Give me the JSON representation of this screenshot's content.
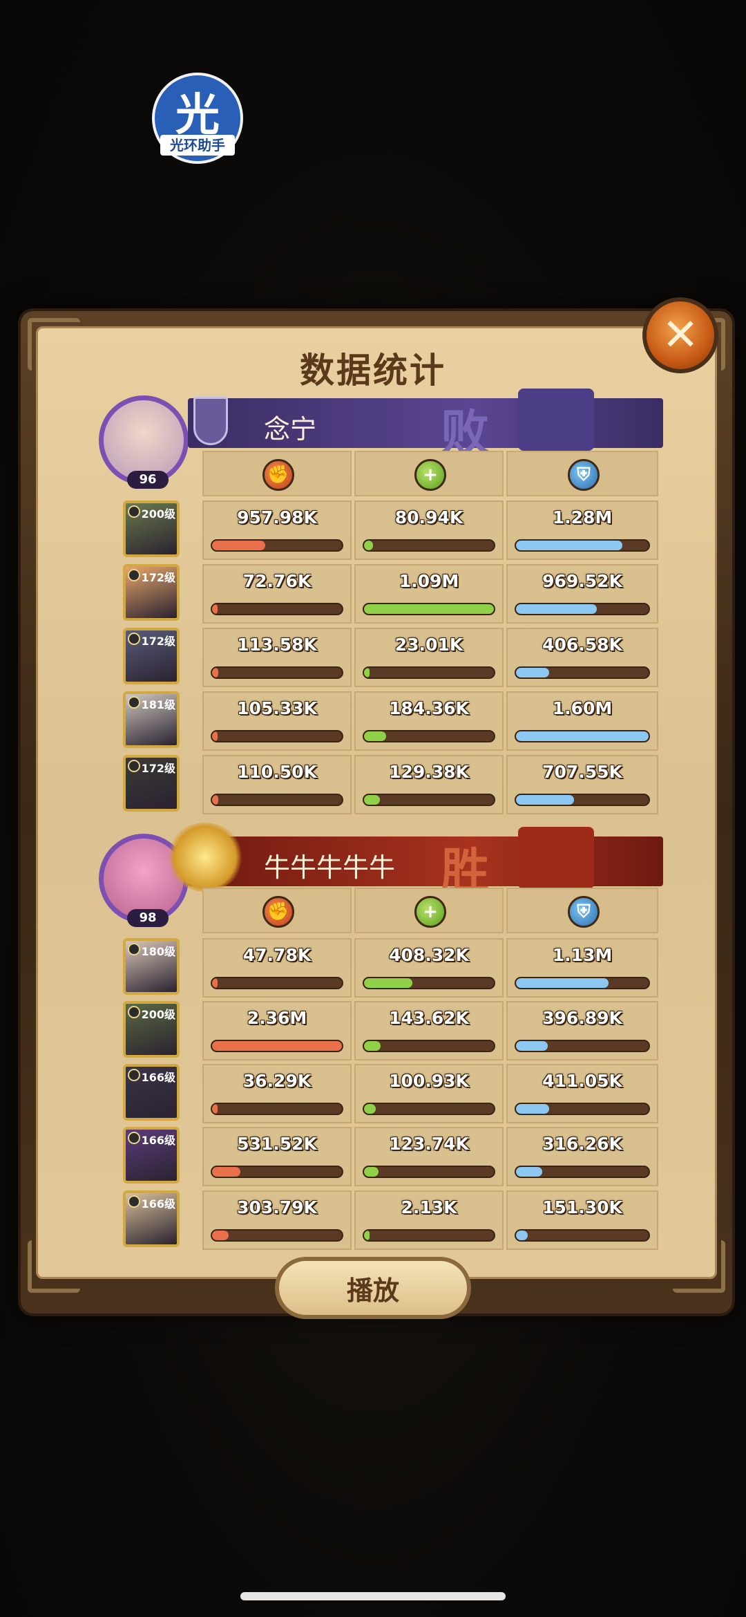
{
  "watermark": {
    "glyph": "光",
    "caption": "光环助手"
  },
  "title": "数据统计",
  "close_label": "✕",
  "stat_icons": {
    "attack": "attack-icon",
    "heal": "heal-icon",
    "defense": "shield-icon"
  },
  "teams": [
    {
      "name": "念宁",
      "result": "败",
      "avatar_level": "96",
      "heroes": [
        {
          "level": "200级",
          "damage": "957.98K",
          "heal": "80.94K",
          "taken": "1.28M",
          "damage_pct": 0.41,
          "heal_pct": 0.07,
          "taken_pct": 0.8
        },
        {
          "level": "172级",
          "damage": "72.76K",
          "heal": "1.09M",
          "taken": "969.52K",
          "damage_pct": 0.03,
          "heal_pct": 1.0,
          "taken_pct": 0.61
        },
        {
          "level": "172级",
          "damage": "113.58K",
          "heal": "23.01K",
          "taken": "406.58K",
          "damage_pct": 0.05,
          "heal_pct": 0.02,
          "taken_pct": 0.25
        },
        {
          "level": "181级",
          "damage": "105.33K",
          "heal": "184.36K",
          "taken": "1.60M",
          "damage_pct": 0.04,
          "heal_pct": 0.17,
          "taken_pct": 1.0
        },
        {
          "level": "172级",
          "damage": "110.50K",
          "heal": "129.38K",
          "taken": "707.55K",
          "damage_pct": 0.05,
          "heal_pct": 0.12,
          "taken_pct": 0.44
        }
      ]
    },
    {
      "name": "牛牛牛牛牛",
      "result": "胜",
      "avatar_level": "98",
      "heroes": [
        {
          "level": "180级",
          "damage": "47.78K",
          "heal": "408.32K",
          "taken": "1.13M",
          "damage_pct": 0.02,
          "heal_pct": 0.37,
          "taken_pct": 0.7
        },
        {
          "level": "200级",
          "damage": "2.36M",
          "heal": "143.62K",
          "taken": "396.89K",
          "damage_pct": 1.0,
          "heal_pct": 0.13,
          "taken_pct": 0.24
        },
        {
          "level": "166级",
          "damage": "36.29K",
          "heal": "100.93K",
          "taken": "411.05K",
          "damage_pct": 0.02,
          "heal_pct": 0.09,
          "taken_pct": 0.25
        },
        {
          "level": "166级",
          "damage": "531.52K",
          "heal": "123.74K",
          "taken": "316.26K",
          "damage_pct": 0.22,
          "heal_pct": 0.11,
          "taken_pct": 0.2
        },
        {
          "level": "166级",
          "damage": "303.79K",
          "heal": "2.13K",
          "taken": "151.30K",
          "damage_pct": 0.13,
          "heal_pct": 0.0,
          "taken_pct": 0.09
        }
      ]
    }
  ],
  "play_button": "播放",
  "colors": {
    "loss_banner": "#4a3a7c",
    "win_banner": "#9b2a1a",
    "attack": "#e8704a",
    "heal": "#8fd24a",
    "defense": "#8cc8f2"
  }
}
